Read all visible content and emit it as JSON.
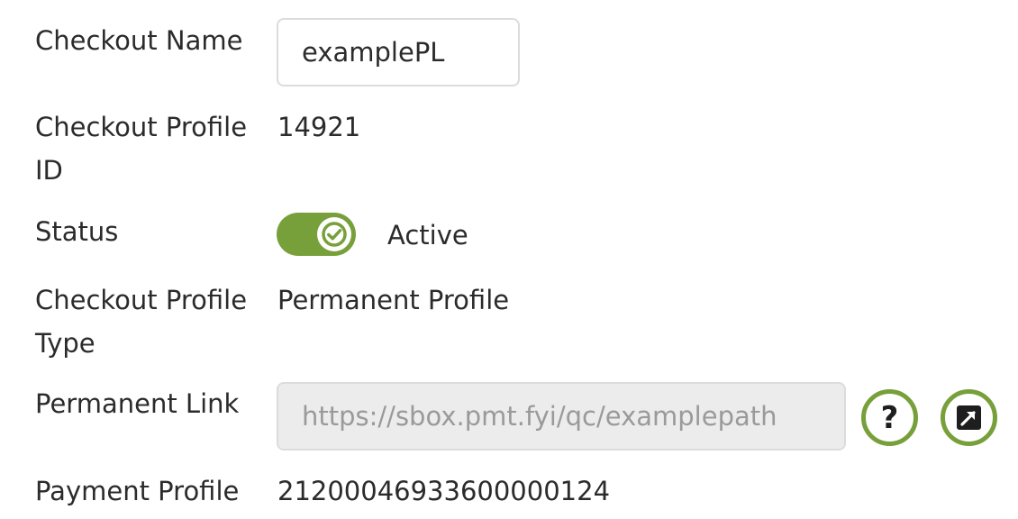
{
  "form": {
    "checkout_name": {
      "label": "Checkout Name",
      "value": "examplePL"
    },
    "checkout_profile_id": {
      "label": "Checkout Profile ID",
      "value": "14921"
    },
    "status": {
      "label": "Status",
      "value": "Active",
      "enabled": true
    },
    "checkout_profile_type": {
      "label": "Checkout Profile Type",
      "value": "Permanent Profile"
    },
    "permanent_link": {
      "label": "Permanent Link",
      "value": "https://sbox.pmt.fyi/qc/examplepath",
      "help_icon": "question-mark-icon",
      "open_icon": "external-link-icon"
    },
    "payment_profile": {
      "label": "Payment Profile",
      "value": "21200046933600000124"
    }
  },
  "colors": {
    "accent": "#77a03b",
    "text": "#2b2b2b",
    "readonly_bg": "#ececec"
  }
}
